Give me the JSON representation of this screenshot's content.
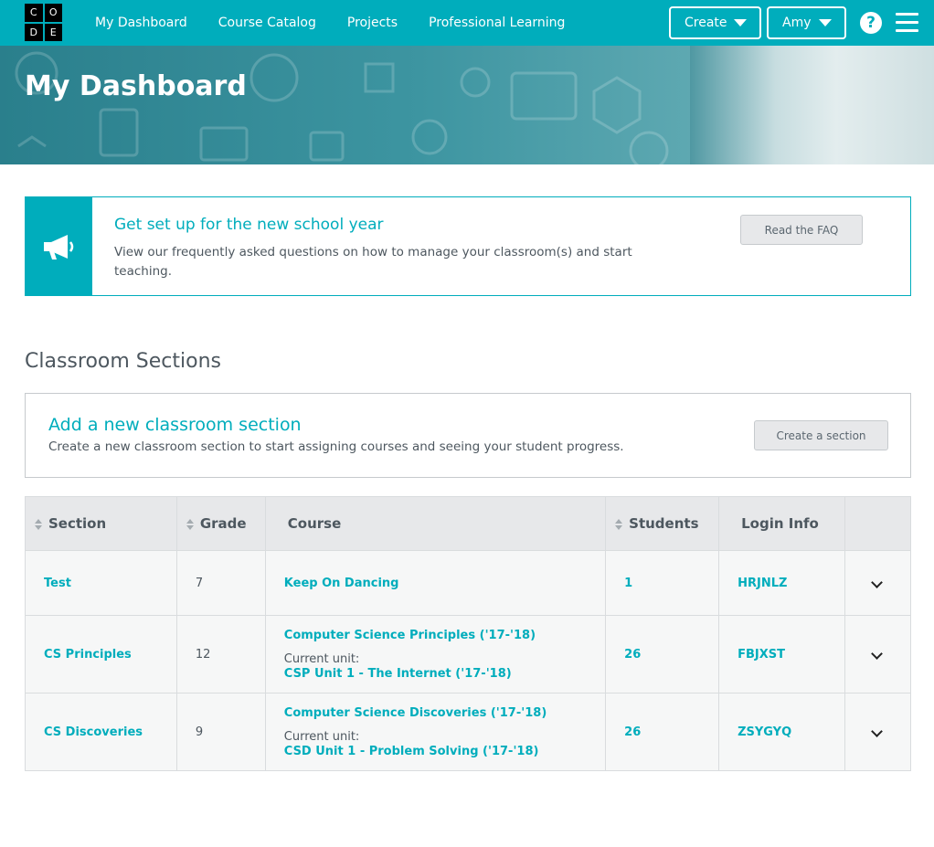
{
  "logo": {
    "letters": [
      "C",
      "O",
      "D",
      "E"
    ]
  },
  "nav": {
    "links": [
      "My Dashboard",
      "Course Catalog",
      "Projects",
      "Professional Learning"
    ],
    "create_label": "Create",
    "user_label": "Amy",
    "help_glyph": "?",
    "help_icon": "question-circle-icon",
    "menu_icon": "hamburger-menu-icon"
  },
  "header": {
    "title": "My Dashboard"
  },
  "notice": {
    "icon": "megaphone-icon",
    "title": "Get set up for the new school year",
    "description": "View our frequently asked questions on how to manage your classroom(s) and start teaching.",
    "button_label": "Read the FAQ"
  },
  "sections": {
    "heading": "Classroom Sections",
    "add": {
      "title": "Add a new classroom section",
      "description": "Create a new classroom section to start assigning courses and seeing your student progress.",
      "button_label": "Create a section"
    },
    "table": {
      "headers": [
        "Section",
        "Grade",
        "Course",
        "Students",
        "Login Info",
        ""
      ],
      "rows": [
        {
          "section": "Test",
          "grade": "7",
          "course": "Keep On Dancing",
          "unit_label": "",
          "unit": "",
          "students": "1",
          "login": "HRJNLZ"
        },
        {
          "section": "CS Principles",
          "grade": "12",
          "course": "Computer Science Principles ('17-'18)",
          "unit_label": "Current unit:",
          "unit": "CSP Unit 1 - The Internet ('17-'18)",
          "students": "26",
          "login": "FBJXST"
        },
        {
          "section": "CS Discoveries",
          "grade": "9",
          "course": "Computer Science Discoveries ('17-'18)",
          "unit_label": "Current unit:",
          "unit": "CSD Unit 1 - Problem Solving ('17-'18)",
          "students": "26",
          "login": "ZSYGYQ"
        }
      ]
    }
  },
  "colors": {
    "brand": "#00adbc",
    "text": "#4d575f",
    "table_header": "#e7e8ea"
  }
}
